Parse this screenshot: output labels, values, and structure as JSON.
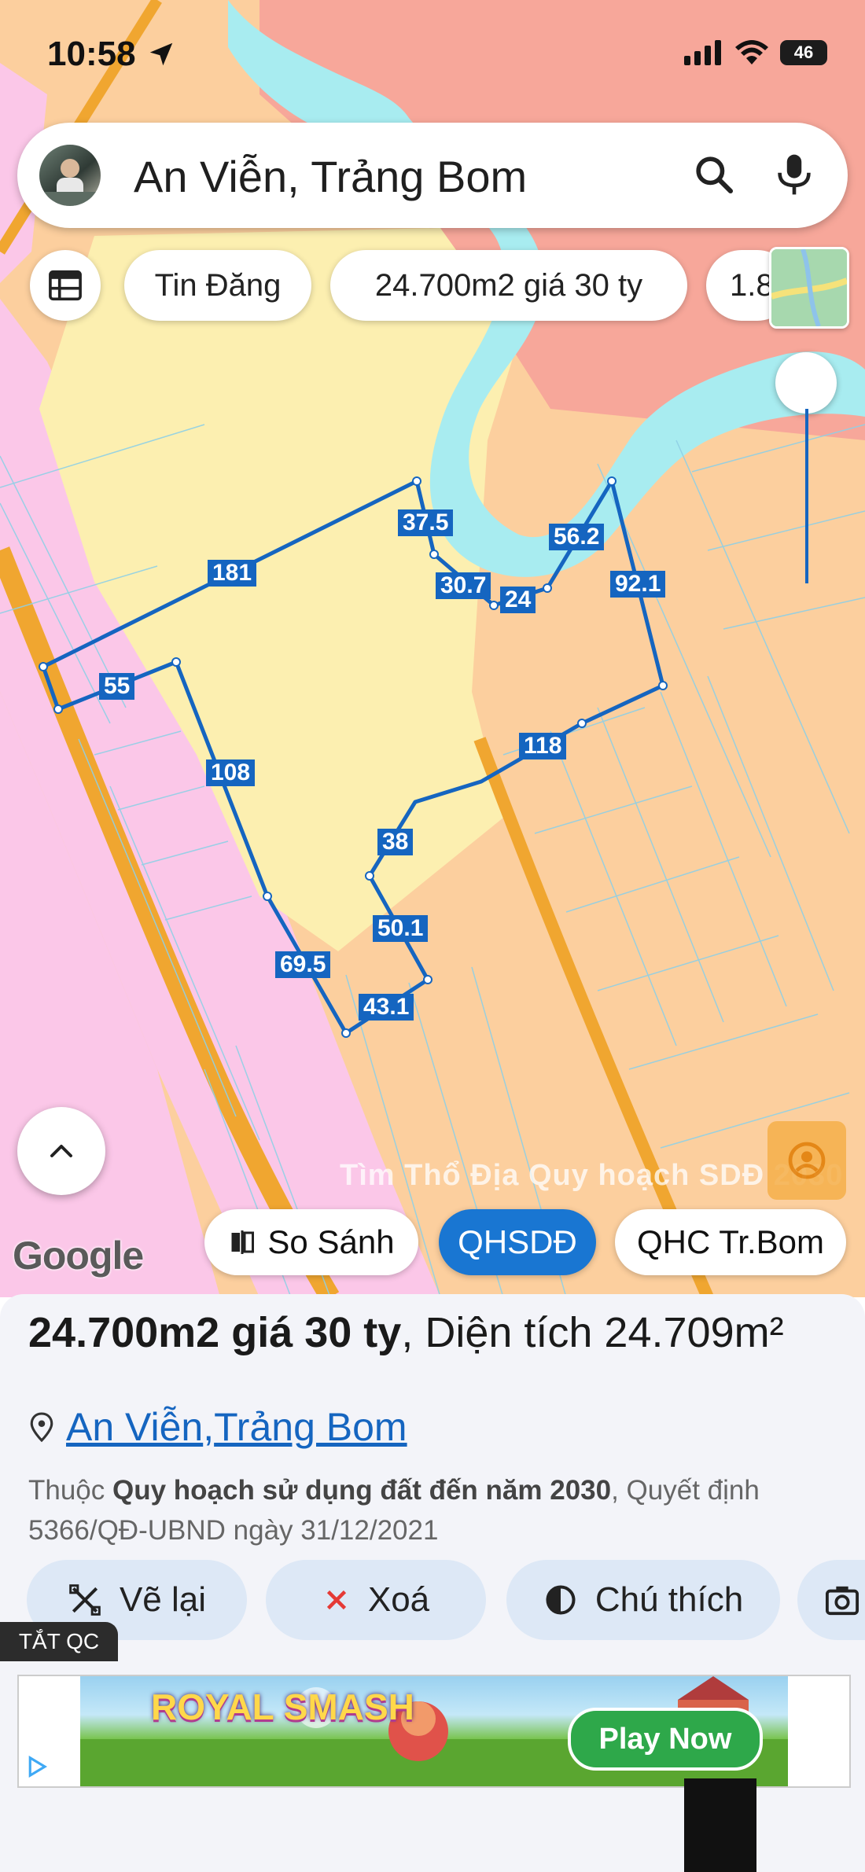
{
  "status_bar": {
    "time": "10:58",
    "battery": "46"
  },
  "search": {
    "query": "An Viễn, Trảng Bom"
  },
  "filter_chips": [
    "Tin Đăng",
    "24.700m2 giá 30 ty",
    "1.8"
  ],
  "map": {
    "parcel_edges": [
      "181",
      "37.5",
      "30.7",
      "24",
      "56.2",
      "92.1",
      "55",
      "108",
      "118",
      "38",
      "50.1",
      "69.5",
      "43.1"
    ],
    "watermark": "Tìm Thổ Địa Quy hoạch SDĐ 2030",
    "attribution": "Google",
    "buttons": {
      "compare": "So Sánh",
      "qhsdd": "QHSDĐ",
      "qhc": "QHC Tr.Bom"
    }
  },
  "detail": {
    "title_bold": "24.700m2 giá 30 ty",
    "title_rest": ", Diện tích 24.709m²",
    "location": {
      "commune": "An Viễn",
      "separator": ", ",
      "district": "Trảng Bom"
    },
    "description": {
      "prefix": "Thuộc ",
      "plan": "Quy hoạch sử dụng đất đến năm 2030",
      "suffix": ", Quyết định 5366/QĐ-UBND ngày 31/12/2021"
    },
    "actions": {
      "redraw": "Vẽ lại",
      "delete": "Xoá",
      "legend": "Chú thích"
    }
  },
  "ad": {
    "toggle_label": "TẮT QC",
    "game_title": "ROYAL SMASH",
    "cta": "Play Now"
  },
  "colors": {
    "accent": "#1976d2",
    "parcel_line": "#1565c0",
    "river": "#a8ecf0",
    "residential": "#fbc7e8",
    "agri": "#fccf9e",
    "rural": "#fcefb0",
    "road": "#f0a630"
  }
}
